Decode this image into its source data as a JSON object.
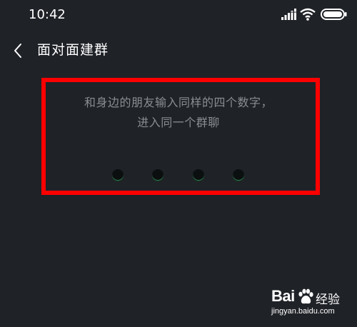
{
  "status_bar": {
    "time": "10:42",
    "icons": [
      "signal-icon",
      "wifi-icon",
      "battery-icon"
    ]
  },
  "header": {
    "back_icon": "chevron-left-icon",
    "title": "面对面建群"
  },
  "prompt": {
    "line1": "和身边的朋友输入同样的四个数字，",
    "line2": "进入同一个群聊"
  },
  "code_input": {
    "digits_entered": 0,
    "digits_total": 4
  },
  "highlight_color": "#ff0000",
  "watermark": {
    "brand_text": "Bai",
    "suffix_text": "经验",
    "url": "jingyan.baidu.com"
  }
}
